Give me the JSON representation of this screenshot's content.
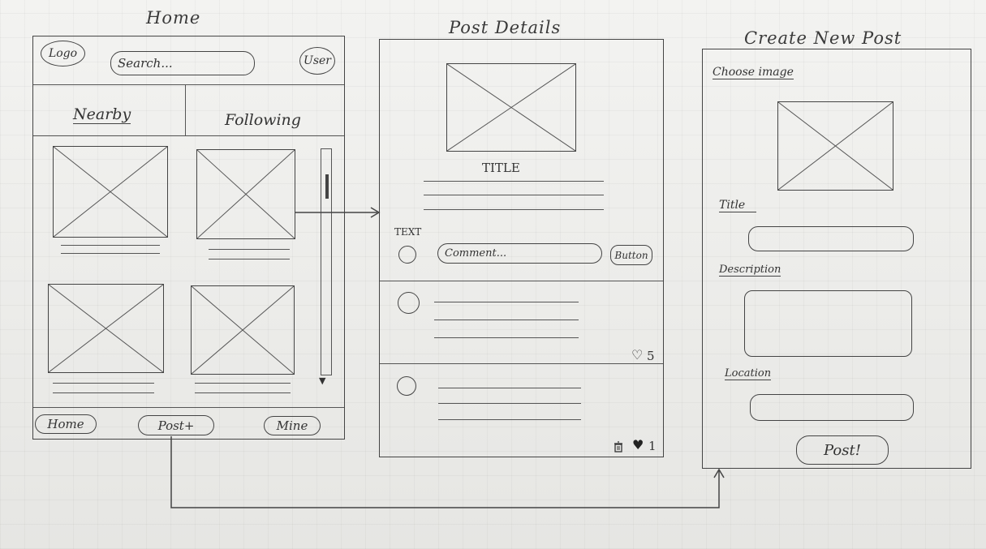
{
  "home": {
    "title": "Home",
    "logo": "Logo",
    "search_placeholder": "Search...",
    "user": "User",
    "tabs": [
      "Nearby",
      "Following"
    ],
    "nav": [
      "Home",
      "Post+",
      "Mine"
    ]
  },
  "post_details": {
    "title": "Post Details",
    "post_title": "TITLE",
    "text_label": "TEXT",
    "comment_placeholder": "Comment...",
    "button_label": "Button",
    "comment_likes": "5",
    "second_likes": "1"
  },
  "create_post": {
    "title": "Create New Post",
    "choose_image": "Choose image",
    "title_label": "Title",
    "description_label": "Description",
    "location_label": "Location",
    "post_button": "Post!"
  },
  "icons": [
    "heart-icon",
    "trash-icon",
    "scroll-arrow-icon"
  ]
}
